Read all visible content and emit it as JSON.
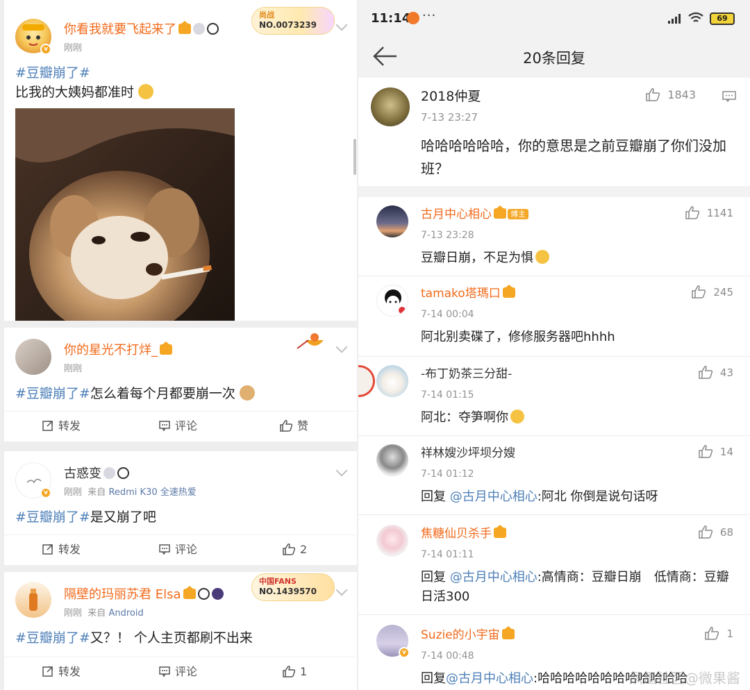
{
  "left": {
    "posts": [
      {
        "user": "你看我就要飞起来了",
        "time": "刚刚",
        "hashtag": "#豆瓣崩了#",
        "text": "比我的大姨妈都准时",
        "fan_badge": {
          "top": "尚战",
          "no": "NO.0073239"
        }
      },
      {
        "user": "你的星光不打烊_",
        "time": "刚刚",
        "hashtag": "#豆瓣崩了#",
        "text": "怎么着每个月都要崩一次",
        "actions": {
          "repost": "转发",
          "comment": "评论",
          "like": "赞"
        }
      },
      {
        "user": "古惑变",
        "time": "刚刚",
        "source_prefix": "来自",
        "source": "Redmi K30 全速热爱",
        "hashtag": "#豆瓣崩了#",
        "text": "是又崩了吧",
        "actions": {
          "repost": "转发",
          "comment": "评论",
          "like": "2"
        }
      },
      {
        "user": "隔壁的玛丽苏君 Elsa",
        "time": "刚刚",
        "source_prefix": "来自",
        "source": "Android",
        "hashtag": "#豆瓣崩了#",
        "text": "又？！ 个人主页都刷不出来",
        "fan_badge": {
          "top": "中国FANS",
          "no": "NO.1439570"
        },
        "actions": {
          "repost": "转发",
          "comment": "评论",
          "like": "1"
        }
      }
    ]
  },
  "right": {
    "status": {
      "time": "11:14",
      "dots": "···",
      "battery": "69"
    },
    "title": "20条回复",
    "main_comment": {
      "user": "2018仲夏",
      "time": "7-13 23:27",
      "likes": "1843",
      "text": "哈哈哈哈哈哈，你的意思是之前豆瓣崩了你们没加班？"
    },
    "replies": [
      {
        "user": "古月中心相心",
        "tag": "博主",
        "time": "7-13 23:28",
        "likes": "1141",
        "text": "豆瓣日崩，不足为惧",
        "name_color": "#f26a1b"
      },
      {
        "user": "tamako塔瑪口",
        "time": "7-14 00:04",
        "likes": "245",
        "text": "阿北别卖碟了，修修服务器吧hhhh",
        "name_color": "#f26a1b"
      },
      {
        "user": "-布丁奶茶三分甜-",
        "time": "7-14 01:15",
        "likes": "43",
        "text": "阿北：夺笋啊你",
        "name_color": "#333333"
      },
      {
        "user": "祥林嫂沙坪坝分嫂",
        "time": "7-14 01:12",
        "likes": "14",
        "reply_prefix": "回复 ",
        "at": "@古月中心相心",
        "text": ":阿北 你倒是说句话呀",
        "name_color": "#333333"
      },
      {
        "user": "焦糖仙贝杀手",
        "time": "7-14 01:11",
        "likes": "68",
        "reply_prefix": "回复 ",
        "at": "@古月中心相心",
        "text": ":高情商：豆瓣日崩　低情商：豆瓣日活300",
        "name_color": "#f26a1b"
      },
      {
        "user": "Suzie的小宇宙",
        "time": "7-14 00:48",
        "likes": "1",
        "reply_prefix": "回复",
        "at": "@古月中心相心",
        "text": ":哈哈哈哈哈哈哈哈哈哈哈哈",
        "name_color": "#f26a1b"
      }
    ],
    "watermark": "凤凰社区@微果酱"
  }
}
